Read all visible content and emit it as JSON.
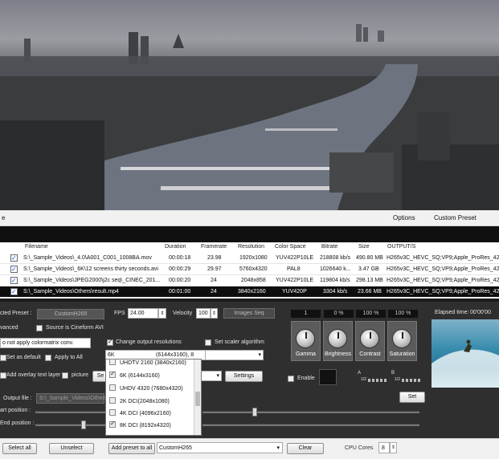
{
  "menu": {
    "options": "Options",
    "custom_preset": "Custom Preset",
    "left_letter": "e"
  },
  "table": {
    "headers": [
      "Filename",
      "Duration",
      "Framerate",
      "Resolution",
      "Color Space",
      "Bitrate",
      "Size",
      "OUTPUT/S"
    ],
    "rows": [
      {
        "checked": true,
        "filename": "S:\\_Sample_Videos\\_4.0\\A001_C001_1008BA.mov",
        "duration": "00:00:18",
        "framerate": "23.98",
        "resolution": "1920x1080",
        "colorspace": "YUV422P10LE",
        "bitrate": "218808 kb/s",
        "size": "490.80 MB",
        "output": "H265v3C_HEVC_SQ;VP9;Apple_ProRes_422"
      },
      {
        "checked": true,
        "filename": "S:\\_Sample_Videos\\_6K\\12 screens thirty seconds.avi",
        "duration": "00:00:29",
        "framerate": "29.97",
        "resolution": "5760x4320",
        "colorspace": "PAL8",
        "bitrate": "1026640 k...",
        "size": "3.47 GB",
        "output": "H265v3C_HEVC_SQ;VP9;Apple_ProRes_422"
      },
      {
        "checked": true,
        "filename": "S:\\_Sample_Videos\\JPEG2000\\j2c seq\\_CINEC_201...",
        "duration": "00:00:20",
        "framerate": "24",
        "resolution": "2048x858",
        "colorspace": "YUV422P10LE",
        "bitrate": "119804 kb/s",
        "size": "298.13 MB",
        "output": "H265v3C_HEVC_SQ;VP9;Apple_ProRes_422"
      },
      {
        "checked": true,
        "filename": "S:\\_Sample_Videos\\Others\\result.mp4",
        "duration": "00:01:00",
        "framerate": "24",
        "resolution": "3840x2160",
        "colorspace": "YUV420P",
        "bitrate": "3304 kb/s",
        "size": "23.66 MB",
        "output": "H265v3C_HEVC_SQ;VP9;Apple_ProRes_422"
      }
    ]
  },
  "panel": {
    "selected_preset_label": "cted Preset :",
    "selected_preset_value": "CustomH265",
    "fps_label": "FPS",
    "fps_value": "24.00",
    "velocity_label": "Velocity",
    "velocity_value": "100",
    "images_seq": "Images Seq",
    "advanced_label": "vanced",
    "source_cineform": "Source is Cineform AVI",
    "colormatrix_value": "o not apply colormatrix conv.",
    "set_as_default": "Set as default",
    "apply_to_all": "Apply to All",
    "change_output_res": "Change output resolutions",
    "set_scaler": "Set scaler algorithm",
    "resolution_value": "6K",
    "resolution_detail": "(6144x3160), 8",
    "add_overlay": "Add overlay text layer",
    "picture": "picture",
    "se_button": "Se",
    "settings_button": "Settings",
    "output_file_label": "Output file :",
    "output_file_value": "S:\\_Sample_Videos\\Others\\",
    "start_position": "art position :",
    "end_position": "End position :",
    "set_button": "Set",
    "enable": "Enable",
    "knobs": [
      {
        "label": "Gamma",
        "value": "1"
      },
      {
        "label": "Brightness",
        "value": "0 %"
      },
      {
        "label": "Contrast",
        "value": "100 %"
      },
      {
        "label": "Saturation",
        "value": "100 %"
      }
    ],
    "elapsed_label": "Elapsed time:",
    "elapsed_value": "00'00'00",
    "channel_a": "A",
    "channel_a_sub": "1/2",
    "channel_b": "B",
    "channel_b_sub": "1/2"
  },
  "dropdown_options": [
    {
      "label": "UHDTV 2160 (3840x2160)",
      "checked": false
    },
    {
      "label": "6K (6144x3160)",
      "checked": true
    },
    {
      "label": "UHDV 4320 (7680x4320)",
      "checked": false
    },
    {
      "label": "2K DCI(2048x1080)",
      "checked": false
    },
    {
      "label": "4K DCI (4096x2160)",
      "checked": false
    },
    {
      "label": "8K DCI (8192x4320)",
      "checked": true
    }
  ],
  "bottom": {
    "select_all": "Select all",
    "unselect": "Unselect",
    "add_preset_to_all": "Add preset to all",
    "preset_value": "CustomH265",
    "clear": "Clear",
    "cpu_cores_label": "CPU Cores",
    "cpu_cores_value": "8"
  }
}
